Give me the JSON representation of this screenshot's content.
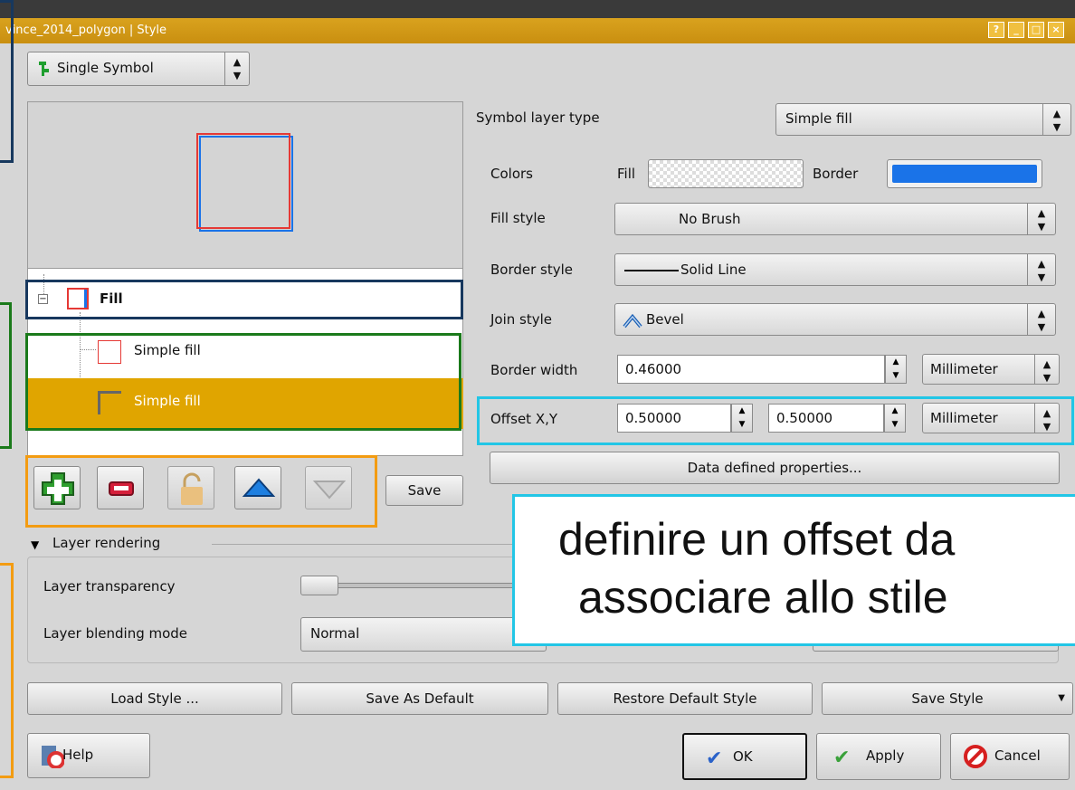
{
  "window": {
    "title": "vince_2014_polygon | Style",
    "buttons": [
      "?",
      "_",
      "□",
      "×"
    ]
  },
  "renderer_combo": {
    "value": "Single Symbol",
    "icon": "single-symbol-icon"
  },
  "symbol_tree": {
    "root_label": "Fill",
    "items": [
      {
        "label": "Simple fill",
        "selected": false
      },
      {
        "label": "Simple fill",
        "selected": true
      }
    ]
  },
  "toolbar": {
    "save_label": "Save",
    "icons": [
      "add-icon",
      "remove-icon",
      "lock-icon",
      "move-up-icon",
      "move-down-icon"
    ]
  },
  "props": {
    "symbol_layer_type_label": "Symbol layer type",
    "symbol_layer_type_value": "Simple fill",
    "colors_label": "Colors",
    "fill_label": "Fill",
    "border_label": "Border",
    "border_color": "#1a73e8",
    "fill_style_label": "Fill style",
    "fill_style_value": "No Brush",
    "border_style_label": "Border style",
    "border_style_value": "Solid Line",
    "join_style_label": "Join style",
    "join_style_value": "Bevel",
    "border_width_label": "Border width",
    "border_width_value": "0.46000",
    "border_width_unit": "Millimeter",
    "offset_label": "Offset X,Y",
    "offset_x": "0.50000",
    "offset_y": "0.50000",
    "offset_unit": "Millimeter",
    "data_defined_label": "Data defined properties..."
  },
  "layer_rendering": {
    "header": "Layer rendering",
    "transparency_label": "Layer transparency",
    "blending_label": "Layer blending mode",
    "blending_value": "Normal"
  },
  "annotation": {
    "line1": "definire un offset da",
    "line2": "associare allo stile"
  },
  "bottom_buttons": {
    "load_style": "Load Style ...",
    "save_as_default": "Save As Default",
    "restore_default": "Restore Default Style",
    "save_style": "Save Style",
    "help": "Help",
    "ok": "OK",
    "apply": "Apply",
    "cancel": "Cancel"
  },
  "colors": {
    "title_bar": "#d9a21e",
    "selection": "#e0a500",
    "accent_cyan": "#22c6e6"
  }
}
